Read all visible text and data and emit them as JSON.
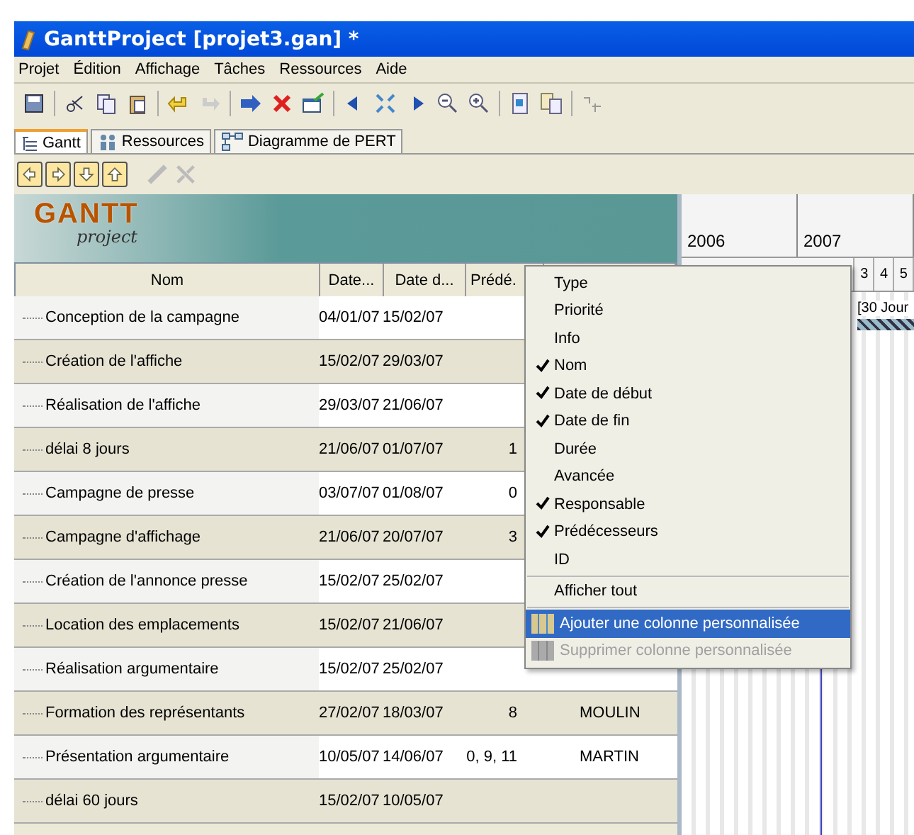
{
  "window": {
    "title": "GanttProject [projet3.gan] *"
  },
  "menu_bar": [
    "Projet",
    "Édition",
    "Affichage",
    "Tâches",
    "Ressources",
    "Aide"
  ],
  "tabs": [
    {
      "label": "Gantt",
      "selected": true
    },
    {
      "label": "Ressources",
      "selected": false
    },
    {
      "label": "Diagramme de PERT",
      "selected": false
    }
  ],
  "logo": {
    "word": "GANTT",
    "sub": "project"
  },
  "table": {
    "columns": [
      "Nom",
      "Date...",
      "Date d...",
      "Prédé."
    ],
    "rows": [
      {
        "name": "Conception de la campagne",
        "start": "04/01/07",
        "end": "15/02/07",
        "pred": "",
        "resp": ""
      },
      {
        "name": "Création de l'affiche",
        "start": "15/02/07",
        "end": "29/03/07",
        "pred": "",
        "resp": ""
      },
      {
        "name": "Réalisation de l'affiche",
        "start": "29/03/07",
        "end": "21/06/07",
        "pred": "",
        "resp": ""
      },
      {
        "name": "délai 8 jours",
        "start": "21/06/07",
        "end": "01/07/07",
        "pred": "1",
        "resp": ""
      },
      {
        "name": "Campagne de presse",
        "start": "03/07/07",
        "end": "01/08/07",
        "pred": "0",
        "resp": ""
      },
      {
        "name": "Campagne d'affichage",
        "start": "21/06/07",
        "end": "20/07/07",
        "pred": "3",
        "resp": ""
      },
      {
        "name": "Création de l'annonce presse",
        "start": "15/02/07",
        "end": "25/02/07",
        "pred": "",
        "resp": ""
      },
      {
        "name": "Location des emplacements",
        "start": "15/02/07",
        "end": "21/06/07",
        "pred": "",
        "resp": ""
      },
      {
        "name": "Réalisation argumentaire",
        "start": "15/02/07",
        "end": "25/02/07",
        "pred": "",
        "resp": ""
      },
      {
        "name": "Formation des représentants",
        "start": "27/02/07",
        "end": "18/03/07",
        "pred": "8",
        "resp": "MOULIN"
      },
      {
        "name": "Présentation argumentaire",
        "start": "10/05/07",
        "end": "14/06/07",
        "pred": "0, 9, 11",
        "resp": "MARTIN"
      },
      {
        "name": "délai 60 jours",
        "start": "15/02/07",
        "end": "10/05/07",
        "pred": "",
        "resp": ""
      }
    ]
  },
  "timeline": {
    "years": [
      "2006",
      "2007"
    ],
    "days": [
      "3",
      "4",
      "5"
    ],
    "bar_label": "[30 Jour"
  },
  "context_menu": [
    {
      "kind": "check",
      "label": "Type",
      "checked": false
    },
    {
      "kind": "check",
      "label": "Priorité",
      "checked": false
    },
    {
      "kind": "check",
      "label": "Info",
      "checked": false
    },
    {
      "kind": "check",
      "label": "Nom",
      "checked": true
    },
    {
      "kind": "check",
      "label": "Date de début",
      "checked": true
    },
    {
      "kind": "check",
      "label": "Date de fin",
      "checked": true
    },
    {
      "kind": "check",
      "label": "Durée",
      "checked": false
    },
    {
      "kind": "check",
      "label": "Avancée",
      "checked": false
    },
    {
      "kind": "check",
      "label": "Responsable",
      "checked": true
    },
    {
      "kind": "check",
      "label": "Prédécesseurs",
      "checked": true
    },
    {
      "kind": "check",
      "label": "ID",
      "checked": false
    },
    {
      "kind": "separator"
    },
    {
      "kind": "action",
      "label": "Afficher tout",
      "selected": false,
      "disabled": false
    },
    {
      "kind": "separator"
    },
    {
      "kind": "icon",
      "label": "Ajouter une colonne personnalisée",
      "selected": true,
      "disabled": false
    },
    {
      "kind": "icon",
      "label": "Supprimer colonne personnalisée",
      "selected": false,
      "disabled": true
    }
  ]
}
